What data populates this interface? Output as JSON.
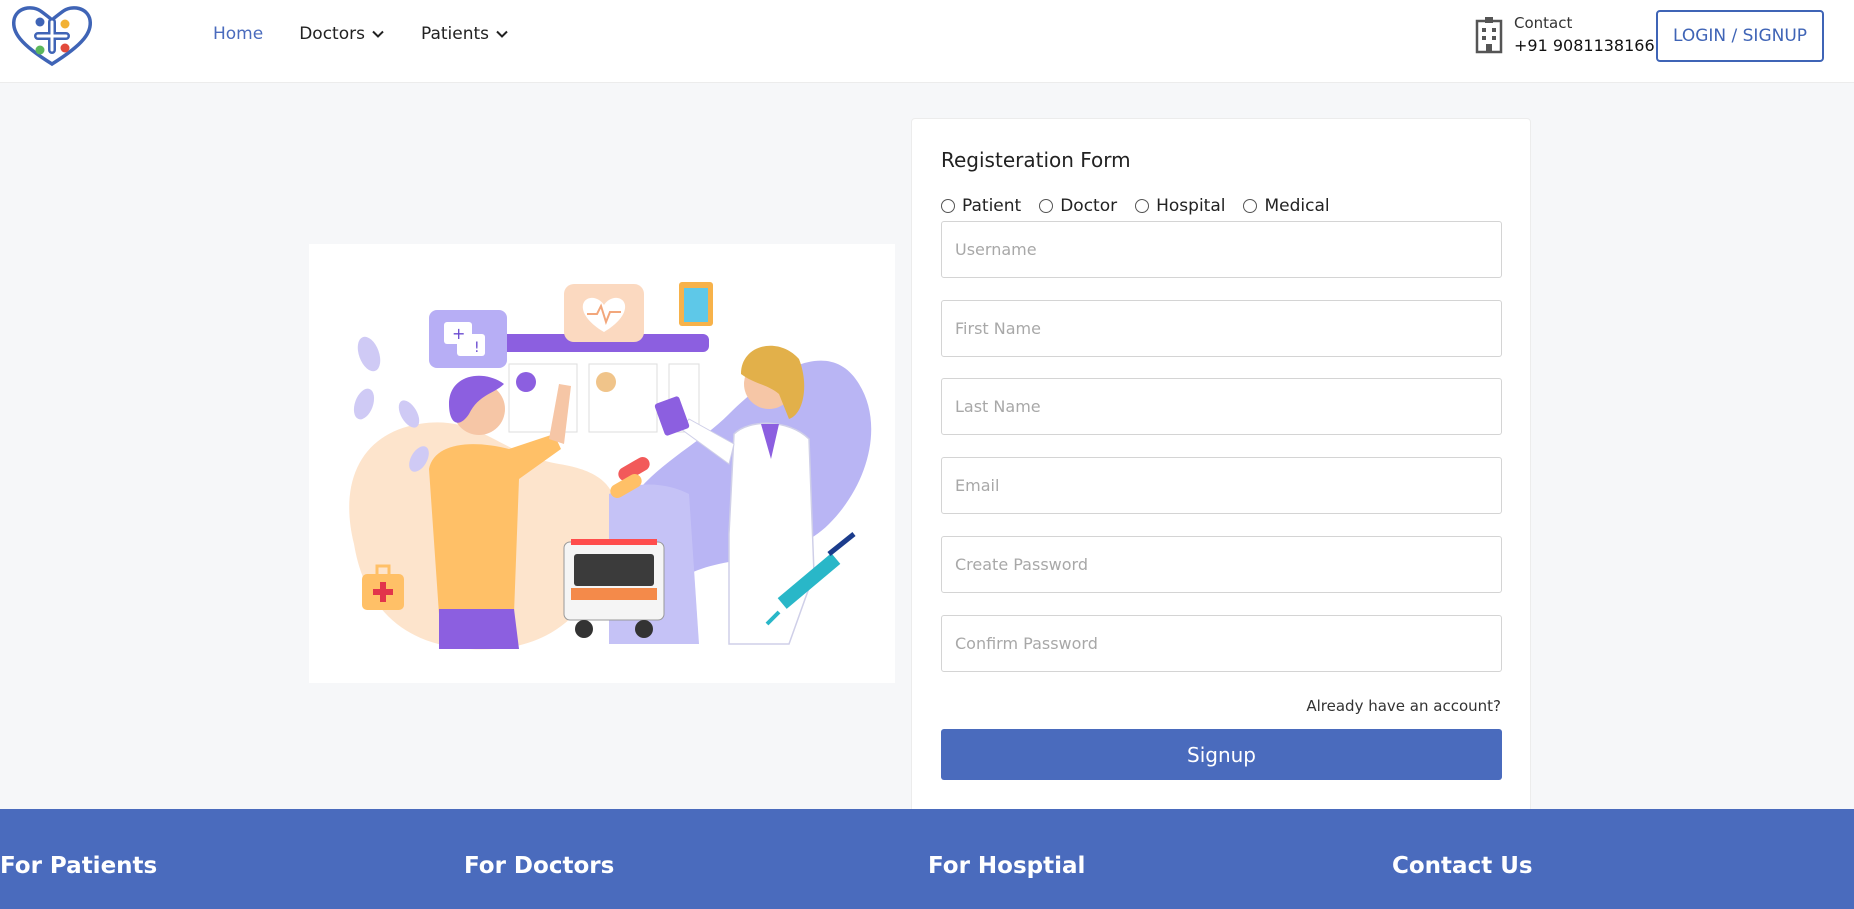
{
  "header": {
    "logo_icon": "medical-cross-heart-logo",
    "nav": [
      {
        "label": "Home",
        "active": true
      },
      {
        "label": "Doctors",
        "dropdown": true
      },
      {
        "label": "Patients",
        "dropdown": true
      }
    ],
    "contact": {
      "icon": "hospital-building-icon",
      "label": "Contact",
      "phone": "+91 9081138166"
    },
    "login_label": "LOGIN / SIGNUP"
  },
  "illustration": {
    "icon": "doctor-patient-illustration"
  },
  "form": {
    "title": "Registeration Form",
    "roles": [
      "Patient",
      "Doctor",
      "Hospital",
      "Medical"
    ],
    "fields": {
      "username": "Username",
      "first_name": "First Name",
      "last_name": "Last Name",
      "email": "Email",
      "create_password": "Create Password",
      "confirm_password": "Confirm Password"
    },
    "already_label": "Already have an account?",
    "signup_label": "Signup"
  },
  "footer": {
    "headings": [
      "For Patients",
      "For Doctors",
      "For Hosptial",
      "Contact Us"
    ]
  },
  "colors": {
    "accent": "#4a6bbd",
    "background": "#f6f7f9"
  }
}
